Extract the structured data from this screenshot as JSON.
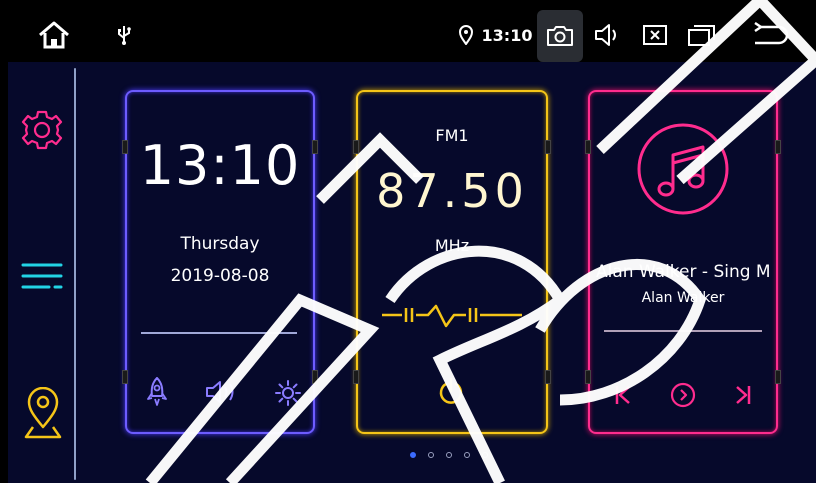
{
  "status_bar": {
    "time": "13:10",
    "icons": [
      "home-icon",
      "usb-icon",
      "location-pin-icon",
      "camera-icon",
      "volume-icon",
      "close-box-icon",
      "recent-apps-icon",
      "back-icon"
    ]
  },
  "sidebar": {
    "items": [
      {
        "icon": "gear-icon"
      },
      {
        "icon": "menu-icon"
      },
      {
        "icon": "navigation-icon"
      }
    ]
  },
  "clock_card": {
    "time": "13:10",
    "day": "Thursday",
    "date": "2019-08-08",
    "buttons": [
      "rocket-icon",
      "speaker-icon",
      "brightness-icon"
    ]
  },
  "radio_card": {
    "band": "FM1",
    "frequency": "87.50",
    "unit": "MHz",
    "buttons": [
      "power-icon"
    ]
  },
  "music_card": {
    "title": "Alan Walker - Sing Me to Sleep",
    "artist": "Alan Walker",
    "progress": 0.0,
    "buttons": [
      "previous-icon",
      "play-icon",
      "next-icon"
    ]
  },
  "pager": {
    "pages": 5,
    "active_index": 0
  },
  "colors": {
    "clock_accent": "#6d5cff",
    "radio_accent": "#f5c518",
    "music_accent": "#ff2c8e",
    "sidebar_settings": "#ff2c8e",
    "sidebar_menu": "#22d3e6",
    "sidebar_nav": "#f5c518",
    "background": "#06092b"
  }
}
